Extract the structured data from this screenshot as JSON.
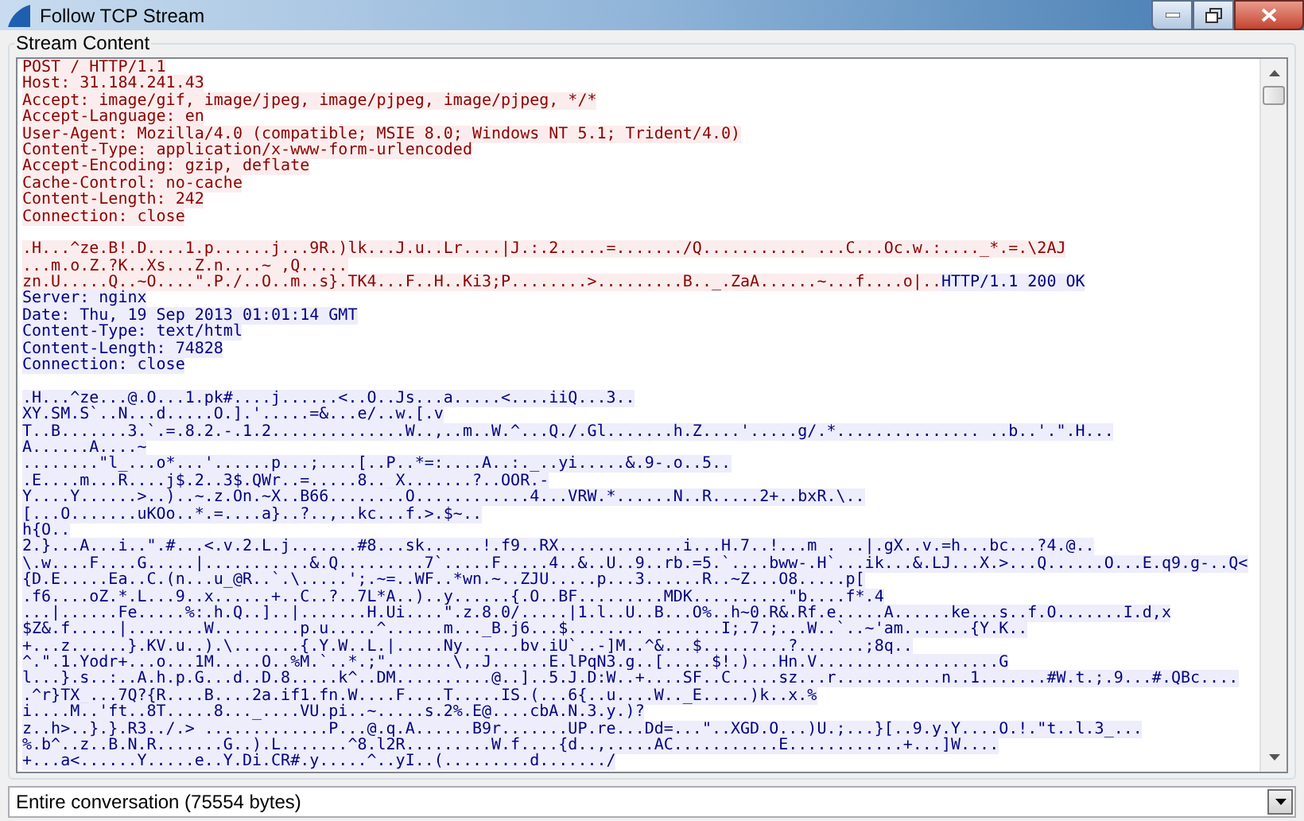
{
  "window": {
    "title": "Follow TCP Stream"
  },
  "stream_group": {
    "label": "Stream Content"
  },
  "stream_blocks": [
    [
      [
        {
          "kind": "client",
          "text": "POST / HTTP/1.1"
        }
      ],
      [
        {
          "kind": "client",
          "text": "Host: 31.184.241.43"
        }
      ],
      [
        {
          "kind": "client",
          "text": "Accept: image/gif, image/jpeg, image/pjpeg, image/pjpeg, */*"
        }
      ],
      [
        {
          "kind": "client",
          "text": "Accept-Language: en"
        }
      ],
      [
        {
          "kind": "client",
          "text": "User-Agent: Mozilla/4.0 (compatible; MSIE 8.0; Windows NT 5.1; Trident/4.0)"
        }
      ],
      [
        {
          "kind": "client",
          "text": "Content-Type: application/x-www-form-urlencoded"
        }
      ],
      [
        {
          "kind": "client",
          "text": "Accept-Encoding: gzip, deflate"
        }
      ],
      [
        {
          "kind": "client",
          "text": "Cache-Control: no-cache"
        }
      ],
      [
        {
          "kind": "client",
          "text": "Content-Length: 242"
        }
      ],
      [
        {
          "kind": "client",
          "text": "Connection: close"
        }
      ]
    ],
    [
      [
        {
          "kind": "client",
          "text": ".H...^ze.B!.D....1.p......j...9R.)lk...J.u..Lr....|J.:.2.....=......./Q........... ...C...Oc.w.:...._*.=.\\2AJ"
        }
      ],
      [
        {
          "kind": "client",
          "text": "...m.o.Z.?K..Xs...Z.n....~ ,Q....."
        }
      ],
      [
        {
          "kind": "client",
          "text": "zn.U.....Q..~O....\".P./..O..m..s}.TK4...F..H..Ki3;P........>.........B.._.ZaA......~...f....o|.."
        },
        {
          "kind": "server",
          "text": "HTTP/1.1 200 OK"
        }
      ],
      [
        {
          "kind": "server",
          "text": "Server: nginx"
        }
      ],
      [
        {
          "kind": "server",
          "text": "Date: Thu, 19 Sep 2013 01:01:14 GMT"
        }
      ],
      [
        {
          "kind": "server",
          "text": "Content-Type: text/html"
        }
      ],
      [
        {
          "kind": "server",
          "text": "Content-Length: 74828"
        }
      ],
      [
        {
          "kind": "server",
          "text": "Connection: close"
        }
      ]
    ],
    [
      [
        {
          "kind": "server",
          "text": ".H...^ze...@.O...1.pk#....j......<..O..Js...a.....<....iiQ...3.."
        }
      ],
      [
        {
          "kind": "server",
          "text": "XY.SM.S`..N...d.....O.].'.....=&...e/..w.[.v"
        }
      ],
      [
        {
          "kind": "server",
          "text": "T..B.......3.`.=.8.2.-.1.2..............W..,..m..W.^...Q./.Gl.......h.Z....'.....g/.*............... ..b..'.\".H..."
        }
      ],
      [
        {
          "kind": "server",
          "text": "A......A....~"
        }
      ],
      [
        {
          "kind": "server",
          "text": "........\"l_...o*...'......p...;....[..P..*=:....A..:._..yi.....&.9-.o..5.."
        }
      ],
      [
        {
          "kind": "server",
          "text": ".E....m...R....j$.2..3$.QWr..=.....8.._X.......?..OOR.-"
        }
      ],
      [
        {
          "kind": "server",
          "text": "Y....Y......>..)..~.z.On.~X..B66........O............4...VRW.*......N..R.....2+..bxR.\\.."
        }
      ],
      [
        {
          "kind": "server",
          "text": "[...O.......uKOo..*.=....a}..?..,..kc...f.>.$~.."
        }
      ],
      [
        {
          "kind": "server",
          "text": "h{O.."
        }
      ],
      [
        {
          "kind": "server",
          "text": "2.}...A...i..\".#...<.v.2.L.j.......#8...sk......!.f9..RX.............i...H.7..!...m . ..|.gX..v.=h...bc...?4.@.."
        }
      ],
      [
        {
          "kind": "server",
          "text": "\\.w....F....G.....|...........&.Q.........7`.....F.....4..&..U..9..rb.=5.`....bww-.H`...ik...&.LJ...X.>...Q......O...E.q9.g-..Q<"
        }
      ],
      [
        {
          "kind": "server",
          "text": "{D.E.....Ea..C.(n...u_@R..`.\\.....';.~=..WF..*wn.~..ZJU.....p...3......R..~Z...O8.....p["
        }
      ],
      [
        {
          "kind": "server",
          "text": ".f6....oZ.*.L...9..x......+..C..?..7L*A..)..y......{.O..BF.........MDK..........\"b....f*.4"
        }
      ],
      [
        {
          "kind": "server",
          "text": "...|......Fe.....%:.h.Q..]..|.......H.Ui....\".z.8.0/.....|1.l..U..B...O%..h~0.R&.Rf.e.....A......ke...s..f.O.......I.d,x"
        }
      ],
      [
        {
          "kind": "server",
          "text": "$Z&.f.....|........W.........p.u.....^......m..._B.j6...$........ .......I;.7.;...W..`..~'am.......{Y.K.."
        }
      ],
      [
        {
          "kind": "server",
          "text": "+...z......}.KV.u..).\\.......{.Y.W..L.|.....Ny......bv.iU`..-]M..^&...$.........?.......;8q.."
        }
      ],
      [
        {
          "kind": "server",
          "text": "^.\".1.Yodr+...o...1M.....O..%M.`..*.;\".......\\,.J......E.lPqN3.g..[.....$!.)...Hn.V...................G"
        }
      ],
      [
        {
          "kind": "server",
          "text": "l...}.s..:..A.h.p.G...d..D.8.....k^..DM..........@..]..5.J.D:W..+....SF..C.....sz...r...........n..1.......#W.t.;.9...#.QBc...."
        }
      ],
      [
        {
          "kind": "server",
          "text": ".^r}TX_...7Q?{R....B....2a.if1.fn.W....F....T.....IS.(...6{..u....W.._E.....)k..x.%"
        }
      ],
      [
        {
          "kind": "server",
          "text": "i....M..'ft..8T.....8..._....VU.pi..~.....s.2%.E@....cbA.N.3.y.)?"
        }
      ],
      [
        {
          "kind": "server",
          "text": "z..h>..}.}.R3../.> .............P...@.q.A......B9r.......UP.re...Dd=...\"..XGD.O...)U.;...}[..9.y.Y....O.!.\"t..l.3_..."
        }
      ],
      [
        {
          "kind": "server",
          "text": "%.b^..z..B.N.R.......G..).L.......^8.l2R.........W.f....{d..,.....AC...........E............+...]W...."
        }
      ],
      [
        {
          "kind": "server",
          "text": "+...a<......Y.....e..Y.Di.CR#.y.....^..yI..(.........d......./"
        }
      ]
    ]
  ],
  "show_select": {
    "value": "Entire conversation (75554 bytes)"
  }
}
